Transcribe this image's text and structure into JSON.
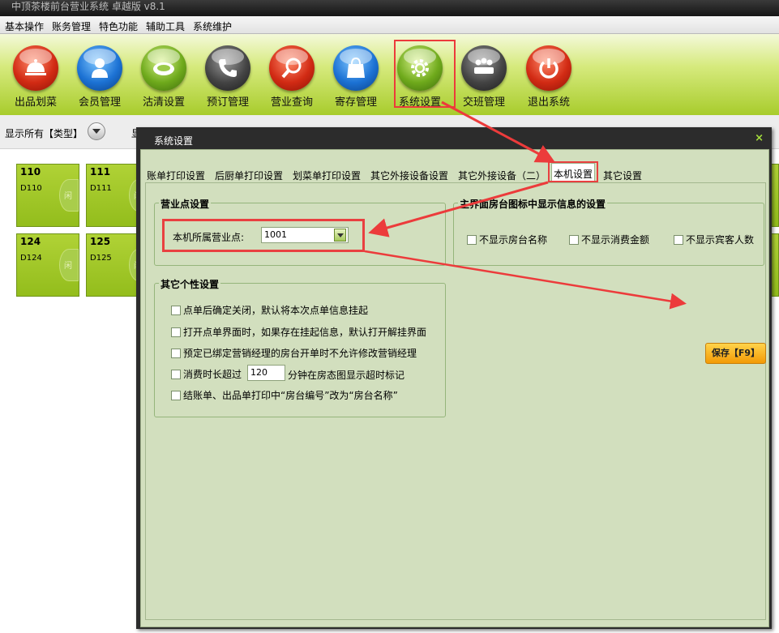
{
  "app": {
    "title": "中顶茶楼前台营业系统 卓越版 v8.1"
  },
  "menubar": [
    "基本操作",
    "账务管理",
    "特色功能",
    "辅助工具",
    "系统维护"
  ],
  "toolbar": [
    {
      "label": "出品划菜",
      "icon": "cloche-icon",
      "color": "#d22b14"
    },
    {
      "label": "会员管理",
      "icon": "user-icon",
      "color": "#1c72d4"
    },
    {
      "label": "沽清设置",
      "icon": "plate-icon",
      "color": "#6faa1c"
    },
    {
      "label": "预订管理",
      "icon": "phone-icon",
      "color": "#444444"
    },
    {
      "label": "营业查询",
      "icon": "magnifier-icon",
      "color": "#d22b14"
    },
    {
      "label": "寄存管理",
      "icon": "bag-icon",
      "color": "#1c72d4"
    },
    {
      "label": "系统设置",
      "icon": "gear-icon",
      "color": "#6faa1c"
    },
    {
      "label": "交班管理",
      "icon": "meeting-icon",
      "color": "#444444"
    },
    {
      "label": "退出系统",
      "icon": "power-icon",
      "color": "#d22b14"
    }
  ],
  "filterbar": {
    "show_all_label": "显示所有【类型】",
    "second_label": "显"
  },
  "rooms": [
    {
      "num": "110",
      "code": "D110",
      "seal": "闲"
    },
    {
      "num": "111",
      "code": "D111",
      "seal": "闲"
    },
    {
      "num": "124",
      "code": "D124",
      "seal": "闲"
    },
    {
      "num": "125",
      "code": "D125",
      "seal": "闲"
    }
  ],
  "dialog": {
    "title": "系统设置",
    "close_glyph": "×",
    "tabs": [
      "账单打印设置",
      "后厨单打印设置",
      "划菜单打印设置",
      "其它外接设备设置",
      "其它外接设备（二）",
      "本机设置",
      "其它设置"
    ],
    "active_tab": "本机设置",
    "outlet_group": {
      "title": "营业点设置",
      "field_label": "本机所属营业点:",
      "field_value": "1001"
    },
    "display_group": {
      "title": "主界面房台图标中显示信息的设置",
      "options": [
        "不显示房台名称",
        "不显示消费金额",
        "不显示宾客人数"
      ]
    },
    "personal_group": {
      "title": "其它个性设置",
      "option1": "点单后确定关闭，默认将本次点单信息挂起",
      "option2": "打开点单界面时，如果存在挂起信息，默认打开解挂界面",
      "option3": "预定已绑定营销经理的房台开单时不允许修改营销经理",
      "option4_prefix": "消费时长超过",
      "option4_value": "120",
      "option4_suffix": "分钟在房态图显示超时标记",
      "option5": "结账单、出品单打印中“房台编号”改为“房台名称”"
    },
    "save_label": "保存【F9】"
  },
  "colors": {
    "accent": "#a8cc2c",
    "annotation": "#ec3b3b",
    "dialog_bg": "#d2dfbe"
  }
}
